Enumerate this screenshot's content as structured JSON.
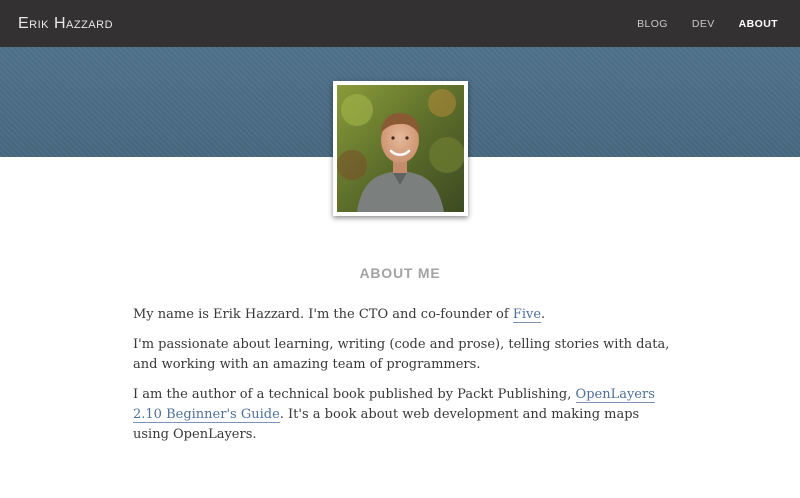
{
  "navbar": {
    "brand": "Erik Hazzard",
    "links": [
      {
        "label": "BLOG",
        "active": false
      },
      {
        "label": "DEV",
        "active": false
      },
      {
        "label": "ABOUT",
        "active": true
      }
    ]
  },
  "colors": {
    "navbar_bg": "#333131",
    "banner_bg": "#4d7089",
    "link": "#4f6f9a",
    "heading": "#a3a3a3"
  },
  "profile": {
    "photo_icon": "profile-photo"
  },
  "about": {
    "heading": "ABOUT ME",
    "p1_text": "My name is Erik Hazzard. I'm the CTO and co-founder of ",
    "p1_link": "Five",
    "p1_end": ".",
    "p2_text": "I'm passionate about learning, writing (code and prose), telling stories with data, and working with an amazing team of programmers.",
    "p3_text": "I am the author of a technical book published by Packt Publishing, ",
    "p3_link": "OpenLayers 2.10 Beginner's Guide",
    "p3_end": ". It's a book about web development and making maps using OpenLayers."
  }
}
